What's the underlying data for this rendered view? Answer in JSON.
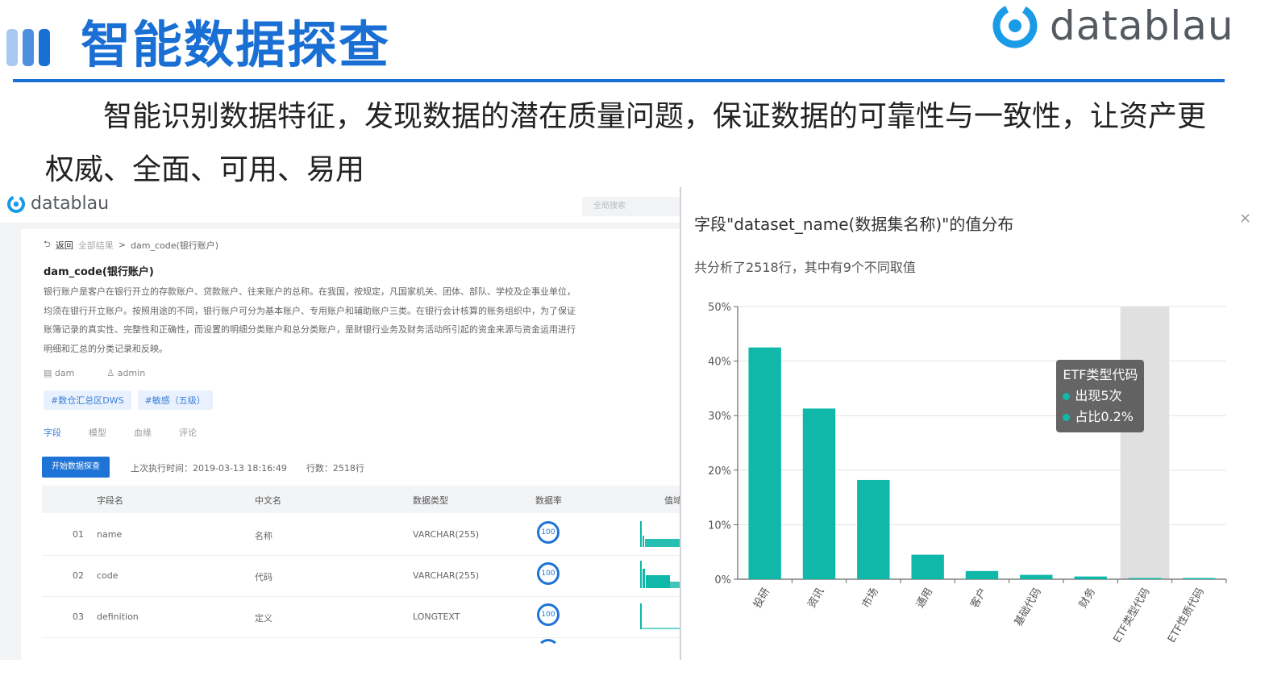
{
  "slide": {
    "title": "智能数据探查",
    "brand": "datablau",
    "intro": "智能识别数据特征，发现数据的潜在质量问题，保证数据的可靠性与一致性，让资产更权威、全面、可用、易用",
    "colors": {
      "title_blue": "#1a6fd4",
      "bar_teal": "#0fb8a8",
      "deco_light": "#a9c8ef",
      "deco_dark": "#1a6fd4"
    }
  },
  "app": {
    "brand": "datablau",
    "search_placeholder": "全局搜索",
    "breadcrumb": {
      "back": "返回",
      "root": "全部结果",
      "sep": ">",
      "current": "dam_code(银行账户)"
    },
    "asset_title": "dam_code(银行账户)",
    "description": "银行账户是客户在银行开立的存款账户、贷款账户、往来账户的总称。在我国，按规定，凡国家机关、团体、部队、学校及企事业单位，均须在银行开立账户。按照用途的不同，银行账户可分为基本账户、专用账户和辅助账户三类。在银行会计核算的账务组织中，为了保证账簿记录的真实性、完整性和正确性，而设置的明细分类账户和总分类账户，是财银行业务及财务活动所引起的资金来源与资金运用进行明细和汇总的分类记录和反映。",
    "meta": {
      "db": "dam",
      "owner": "admin"
    },
    "tags": [
      "#数仓汇总区DWS",
      "#敏感（五级）"
    ],
    "tabs": [
      {
        "label": "字段",
        "active": true
      },
      {
        "label": "模型",
        "active": false
      },
      {
        "label": "血缘",
        "active": false
      },
      {
        "label": "评论",
        "active": false
      }
    ],
    "start_button": "开始数据探查",
    "last_run_label": "上次执行时间：",
    "last_run_value": "2019-03-13 18:16:49",
    "rows_label": "行数：",
    "rows_value": "2518行",
    "table": {
      "headers": [
        "字段名",
        "中文名",
        "数据类型",
        "数据率",
        "值域分布"
      ],
      "rows": [
        {
          "no": "01",
          "field": "name",
          "cn": "名称",
          "type": "VARCHAR(255)",
          "rate": "100"
        },
        {
          "no": "02",
          "field": "code",
          "cn": "代码",
          "type": "VARCHAR(255)",
          "rate": "100"
        },
        {
          "no": "03",
          "field": "definition",
          "cn": "定义",
          "type": "LONGTEXT",
          "rate": "100"
        }
      ]
    }
  },
  "panel": {
    "title": "字段\"dataset_name(数据集名称)\"的值分布",
    "subtitle": "共分析了2518行，其中有9个不同取值",
    "close": "×",
    "tooltip": {
      "title": "ETF类型代码",
      "count": "出现5次",
      "ratio": "占比0.2%"
    }
  },
  "chart_data": {
    "type": "bar",
    "categories": [
      "投研",
      "资讯",
      "市场",
      "通用",
      "客户",
      "基础代码",
      "财务",
      "ETF类型代码",
      "ETF性质代码"
    ],
    "values": [
      42.5,
      31.3,
      18.2,
      4.5,
      1.5,
      0.8,
      0.5,
      0.2,
      0.1
    ],
    "ylim": [
      0,
      50
    ],
    "yticks": [
      "0%",
      "10%",
      "20%",
      "30%",
      "40%",
      "50%"
    ],
    "highlight_index": 7,
    "grid": true,
    "color": "#0fb8a8"
  }
}
